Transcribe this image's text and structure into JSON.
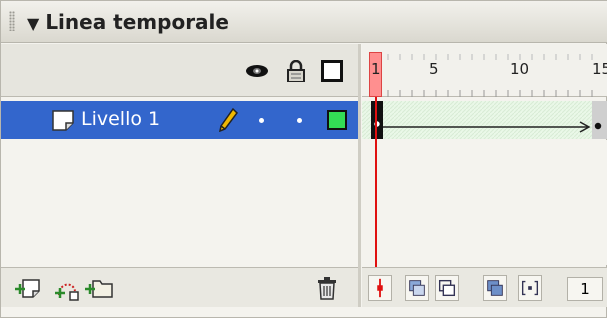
{
  "panel": {
    "title": "Linea temporale",
    "collapse_glyph": "▼"
  },
  "layers": [
    {
      "name": "Livello 1",
      "color": "#33dd55",
      "selected": true
    }
  ],
  "frames": {
    "ruler_numbers": [
      "1",
      "5",
      "10",
      "15"
    ],
    "current": "1"
  },
  "icons": {
    "header": [
      "eye-icon",
      "lock-icon",
      "outline-icon"
    ],
    "layer_toolbar": [
      "add-layer-icon",
      "add-motion-guide-icon",
      "add-folder-icon",
      "trash-icon"
    ],
    "frame_toolbar": [
      "center-frame-icon",
      "onion-skin-icon",
      "onion-skin-outlines-icon",
      "edit-multiple-frames-icon",
      "modify-onion-markers-icon"
    ]
  },
  "colors": {
    "selected_row": "#3366cc",
    "playhead": "#e01010",
    "tween_fill": "#eaf8e8"
  }
}
